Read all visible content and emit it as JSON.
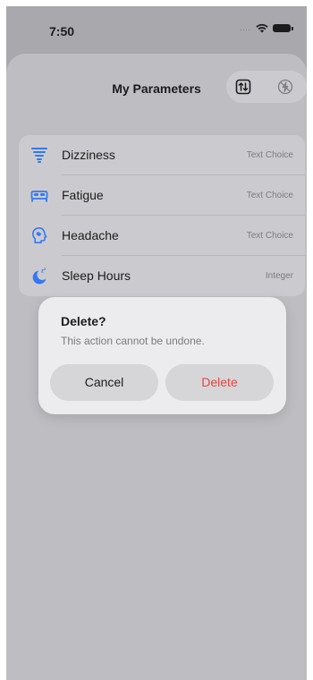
{
  "status_bar": {
    "time": "7:50",
    "signal": "....",
    "icons": [
      "signal-dots-icon",
      "wifi-icon",
      "battery-icon"
    ]
  },
  "header": {
    "title": "My Parameters",
    "actions": [
      {
        "name": "sort-icon"
      },
      {
        "name": "flash-off-icon"
      }
    ]
  },
  "parameters": [
    {
      "icon": "tornado-icon",
      "label": "Dizziness",
      "type": "Text Choice",
      "icon_color": "#3478f6"
    },
    {
      "icon": "bed-icon",
      "label": "Fatigue",
      "type": "Text Choice",
      "icon_color": "#3478f6"
    },
    {
      "icon": "head-profile-icon",
      "label": "Headache",
      "type": "Text Choice",
      "icon_color": "#3478f6"
    },
    {
      "icon": "moon-zzz-icon",
      "label": "Sleep Hours",
      "type": "Integer",
      "icon_color": "#3478f6"
    }
  ],
  "alert": {
    "title": "Delete?",
    "message": "This action cannot be undone.",
    "cancel_label": "Cancel",
    "delete_label": "Delete",
    "delete_color": "#e5463f"
  }
}
